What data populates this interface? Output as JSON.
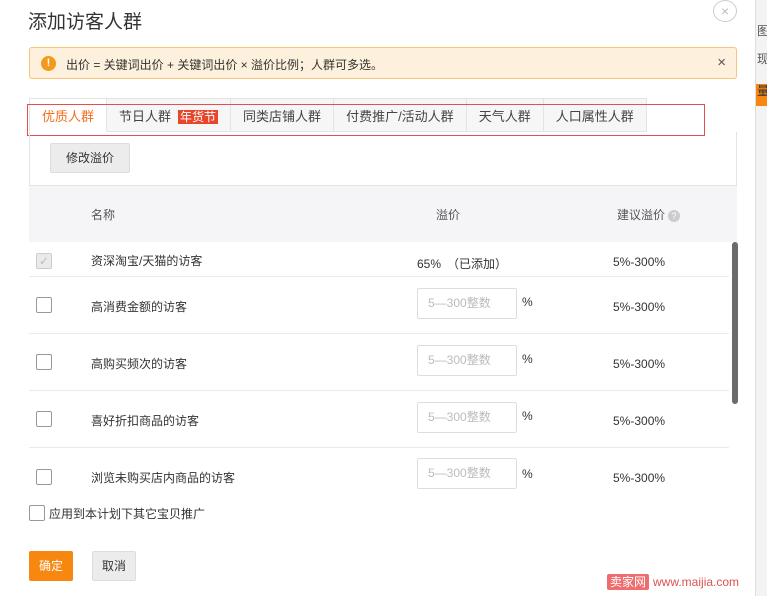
{
  "dialog": {
    "title": "添加访客人群",
    "close_symbol": "×"
  },
  "notice": {
    "icon": "!",
    "text": "出价 = 关键词出价 + 关键词出价 × 溢价比例；人群可多选。",
    "close_symbol": "×"
  },
  "tabs": [
    {
      "label": "优质人群",
      "active": true
    },
    {
      "label": "节日人群",
      "tag": "年货节"
    },
    {
      "label": "同类店铺人群"
    },
    {
      "label": "付费推广/活动人群"
    },
    {
      "label": "天气人群"
    },
    {
      "label": "人口属性人群"
    }
  ],
  "toolbar": {
    "modify_label": "修改溢价"
  },
  "table": {
    "headers": {
      "name": "名称",
      "premium": "溢价",
      "suggest": "建议溢价",
      "help_icon": "?"
    },
    "rows": [
      {
        "name": "资深淘宝/天猫的访客",
        "premium": "65%　（已添加）",
        "suggest": "5%-300%",
        "checked": true
      },
      {
        "name": "高消费金额的访客",
        "placeholder": "5—300整数",
        "unit": "%",
        "suggest": "5%-300%"
      },
      {
        "name": "高购买频次的访客",
        "placeholder": "5—300整数",
        "unit": "%",
        "suggest": "5%-300%"
      },
      {
        "name": "喜好折扣商品的访客",
        "placeholder": "5—300整数",
        "unit": "%",
        "suggest": "5%-300%"
      },
      {
        "name": "浏览未购买店内商品的访客",
        "placeholder": "5—300整数",
        "unit": "%",
        "suggest": "5%-300%"
      }
    ]
  },
  "apply_all_label": "应用到本计划下其它宝贝推广",
  "buttons": {
    "confirm": "确定",
    "cancel": "取消"
  },
  "right_strip": [
    "图",
    "现",
    "量"
  ],
  "watermark": {
    "brand": "卖家网",
    "url": "www.maijia.com"
  },
  "colors": {
    "accent": "#f7870f",
    "tab_active": "#f46e1e",
    "tag": "#e8452b",
    "highlight_box": "#e84c4c"
  }
}
